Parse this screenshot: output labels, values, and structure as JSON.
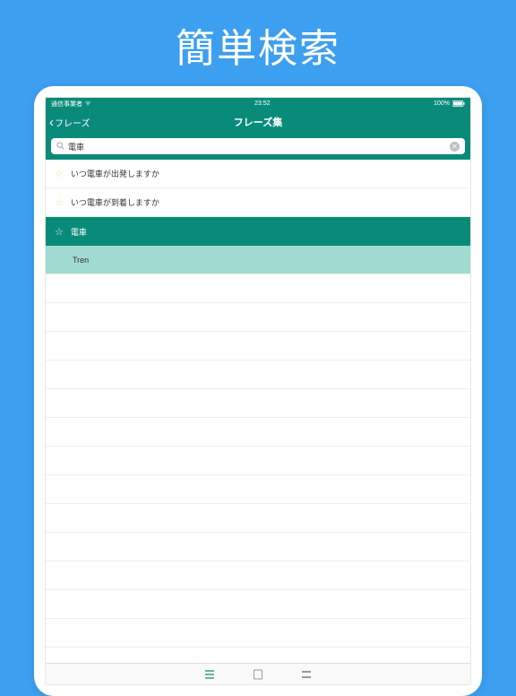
{
  "promo": {
    "title": "簡単検索"
  },
  "status": {
    "carrier": "通信事業者",
    "time": "23:52",
    "battery": "100%"
  },
  "nav": {
    "back_label": "フレーズ",
    "title": "フレーズ集"
  },
  "search": {
    "value": "電車"
  },
  "results": [
    {
      "text": "いつ電車が出発しますか",
      "selected": false
    },
    {
      "text": "いつ電車が到着しますか",
      "selected": false
    },
    {
      "text": "電車",
      "selected": true,
      "translation": "Tren"
    }
  ]
}
